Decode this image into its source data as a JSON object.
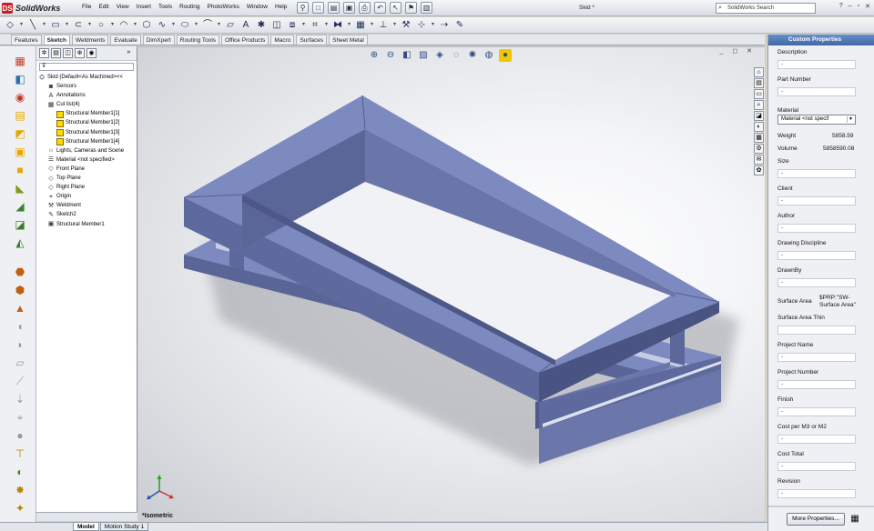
{
  "app": {
    "name": "SolidWorks",
    "logo": "DS",
    "doc_title": "Skid *"
  },
  "menu": [
    "File",
    "Edit",
    "View",
    "Insert",
    "Tools",
    "Routing",
    "PhotoWorks",
    "Window",
    "Help"
  ],
  "search": {
    "placeholder": "SolidWorks Search"
  },
  "quick_access_icons": [
    "new-icon",
    "open-icon",
    "save-icon",
    "print-icon",
    "undo-icon",
    "select-icon",
    "rebuild-icon",
    "options-icon"
  ],
  "sketch_tools": [
    "smart-dimension",
    "line",
    "rectangle",
    "slot",
    "circle",
    "arc",
    "polygon",
    "spline",
    "ellipse",
    "fillet",
    "plane",
    "text",
    "point",
    "convert-entities",
    "offset",
    "trim",
    "mirror",
    "move",
    "display-relations",
    "repair-sketch",
    "quick-snaps",
    "rapid-sketch",
    "instant-2d"
  ],
  "tabs": [
    "Features",
    "Sketch",
    "Weldments",
    "Evaluate",
    "DimXpert",
    "Routing Tools",
    "Office Products",
    "Macro",
    "Surfaces",
    "Sheet Metal"
  ],
  "active_tab": "Sketch",
  "tree": {
    "root": "Skid  (Default<As Machined><<",
    "items": [
      {
        "label": "Sensors",
        "icon": "sensor-icon",
        "indent": 1
      },
      {
        "label": "Annotations",
        "icon": "annotation-icon",
        "indent": 1
      },
      {
        "label": "Cut list(4)",
        "icon": "cutlist-icon",
        "indent": 1
      },
      {
        "label": "Structural Member1[1]",
        "icon": "folder-icon",
        "indent": 2
      },
      {
        "label": "Structural Member1[2]",
        "icon": "folder-icon",
        "indent": 2
      },
      {
        "label": "Structural Member1[3]",
        "icon": "folder-icon",
        "indent": 2
      },
      {
        "label": "Structural Member1[4]",
        "icon": "folder-icon",
        "indent": 2
      },
      {
        "label": "Lights, Cameras and Scene",
        "icon": "lights-icon",
        "indent": 1
      },
      {
        "label": "Material <not specified>",
        "icon": "material-icon",
        "indent": 1
      },
      {
        "label": "Front Plane",
        "icon": "plane-icon",
        "indent": 1
      },
      {
        "label": "Top Plane",
        "icon": "plane-icon",
        "indent": 1
      },
      {
        "label": "Right Plane",
        "icon": "plane-icon",
        "indent": 1
      },
      {
        "label": "Origin",
        "icon": "origin-icon",
        "indent": 1
      },
      {
        "label": "Weldment",
        "icon": "weldment-icon",
        "indent": 1
      },
      {
        "label": "Sketch2",
        "icon": "sketch-icon",
        "indent": 1
      },
      {
        "label": "Structural Member1",
        "icon": "member-icon",
        "indent": 1
      }
    ]
  },
  "bottom_tabs": [
    "Model",
    "Motion Study 1"
  ],
  "view": {
    "label": "*Isometric"
  },
  "props": {
    "title": "Custom Properties",
    "fields": [
      {
        "label": "Description",
        "value": "-"
      },
      {
        "label": "Part Number",
        "value": "-"
      },
      {
        "label": "Size",
        "value": "-"
      },
      {
        "label": "Client",
        "value": "-"
      },
      {
        "label": "Author",
        "value": "-"
      },
      {
        "label": "Drawing Discipline",
        "value": "-"
      },
      {
        "label": "DrawnBy",
        "value": "-"
      },
      {
        "label": "Surface Area  Thin",
        "value": ""
      },
      {
        "label": "Project Name",
        "value": "-"
      },
      {
        "label": "Project Number",
        "value": "-"
      },
      {
        "label": "Finish",
        "value": "-"
      },
      {
        "label": "Cost per M3 or M2",
        "value": "-"
      },
      {
        "label": "Cost Total",
        "value": "-"
      },
      {
        "label": "Revision",
        "value": "-"
      }
    ],
    "material_label": "Material",
    "material_value": "Material <not specif",
    "weight_label": "Weight",
    "weight_value": "5858.59",
    "volume_label": "Volume",
    "volume_value": "5858590.08",
    "surface_label": "Surface Area",
    "surface_value": "$PRP:\"SW-Surface Area\"",
    "more_button": "More Properties..."
  },
  "colors": {
    "model_top": "#7d8ac0",
    "model_side": "#5c679a",
    "model_dark": "#4a5483",
    "panel_title": "#3e66a8"
  }
}
